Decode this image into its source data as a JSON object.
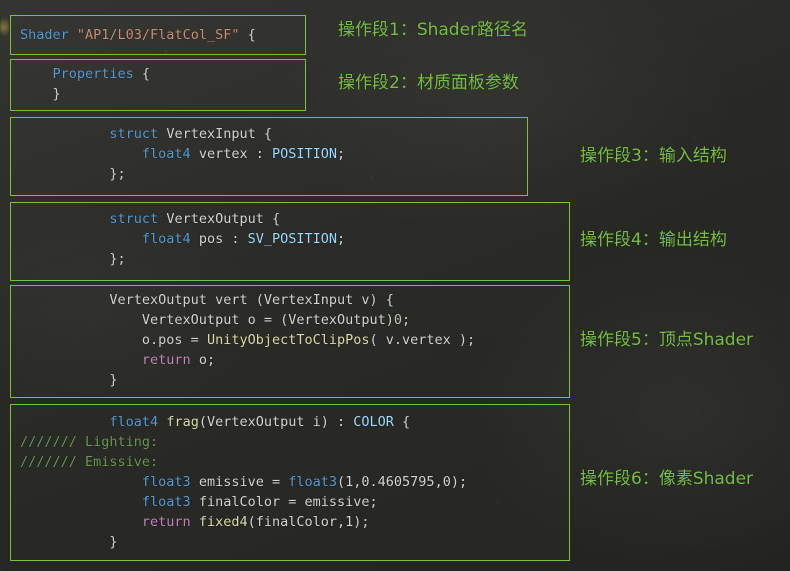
{
  "theme": {
    "background": "#2b2b28",
    "box_border": "#7ac143",
    "annotation_color": "#78c043",
    "code_default": "#d4d4d4",
    "keyword": "#569cd6",
    "string": "#ce9178",
    "semantic": "#9cdcfe",
    "function": "#dcdcaa",
    "return_kw": "#c586c0",
    "comment": "#6a9955"
  },
  "blocks": [
    {
      "id": "shader-path",
      "annotation": "操作段1：Shader路径名",
      "lines": [
        [
          {
            "t": "Shader ",
            "c": "kw"
          },
          {
            "t": "\"AP1/L03/FlatCol_SF\"",
            "c": "str"
          },
          {
            "t": " {",
            "c": "pln"
          }
        ]
      ]
    },
    {
      "id": "properties",
      "annotation": "操作段2：材质面板参数",
      "lines": [
        [
          {
            "t": "    ",
            "c": "pln"
          },
          {
            "t": "Properties",
            "c": "kw"
          },
          {
            "t": " {",
            "c": "pln"
          }
        ],
        [
          {
            "t": "    }",
            "c": "pln"
          }
        ]
      ]
    },
    {
      "id": "vertex-input-struct",
      "annotation": "操作段3：输入结构",
      "lines": [
        [
          {
            "t": "           ",
            "c": "pln"
          },
          {
            "t": "struct",
            "c": "kw"
          },
          {
            "t": " VertexInput {",
            "c": "pln"
          }
        ],
        [
          {
            "t": "               ",
            "c": "pln"
          },
          {
            "t": "float4",
            "c": "kw"
          },
          {
            "t": " vertex : ",
            "c": "pln"
          },
          {
            "t": "POSITION",
            "c": "sem"
          },
          {
            "t": ";",
            "c": "pln"
          }
        ],
        [
          {
            "t": "           };",
            "c": "pln"
          }
        ]
      ]
    },
    {
      "id": "vertex-output-struct",
      "annotation": "操作段4：输出结构",
      "lines": [
        [
          {
            "t": "           ",
            "c": "pln"
          },
          {
            "t": "struct",
            "c": "kw"
          },
          {
            "t": " VertexOutput {",
            "c": "pln"
          }
        ],
        [
          {
            "t": "               ",
            "c": "pln"
          },
          {
            "t": "float4",
            "c": "kw"
          },
          {
            "t": " pos : ",
            "c": "pln"
          },
          {
            "t": "SV_POSITION",
            "c": "sem"
          },
          {
            "t": ";",
            "c": "pln"
          }
        ],
        [
          {
            "t": "           };",
            "c": "pln"
          }
        ]
      ]
    },
    {
      "id": "vertex-shader",
      "annotation": "操作段5：顶点Shader",
      "lines": [
        [
          {
            "t": "           VertexOutput vert (VertexInput v) {",
            "c": "pln"
          }
        ],
        [
          {
            "t": "               VertexOutput o = (VertexOutput)",
            "c": "pln"
          },
          {
            "t": "0",
            "c": "num"
          },
          {
            "t": ";",
            "c": "pln"
          }
        ],
        [
          {
            "t": "               o.pos = ",
            "c": "pln"
          },
          {
            "t": "UnityObjectToClipPos",
            "c": "fn"
          },
          {
            "t": "( v.vertex );",
            "c": "pln"
          }
        ],
        [
          {
            "t": "               ",
            "c": "pln"
          },
          {
            "t": "return",
            "c": "ret"
          },
          {
            "t": " o;",
            "c": "pln"
          }
        ],
        [
          {
            "t": "           }",
            "c": "pln"
          }
        ]
      ]
    },
    {
      "id": "fragment-shader",
      "annotation": "操作段6：像素Shader",
      "lines": [
        [
          {
            "t": "           ",
            "c": "pln"
          },
          {
            "t": "float4",
            "c": "kw"
          },
          {
            "t": " ",
            "c": "pln"
          },
          {
            "t": "frag",
            "c": "fn"
          },
          {
            "t": "(VertexOutput i) : ",
            "c": "pln"
          },
          {
            "t": "COLOR",
            "c": "sem"
          },
          {
            "t": " {",
            "c": "pln"
          }
        ],
        [
          {
            "t": "/////// Lighting:",
            "c": "cmt"
          }
        ],
        [
          {
            "t": "/////// Emissive:",
            "c": "cmt"
          }
        ],
        [
          {
            "t": "               ",
            "c": "pln"
          },
          {
            "t": "float3",
            "c": "kw"
          },
          {
            "t": " emissive = ",
            "c": "pln"
          },
          {
            "t": "float3",
            "c": "kw"
          },
          {
            "t": "(1,0.4605795,0);",
            "c": "pln"
          }
        ],
        [
          {
            "t": "               ",
            "c": "pln"
          },
          {
            "t": "float3",
            "c": "kw"
          },
          {
            "t": " finalColor = emissive;",
            "c": "pln"
          }
        ],
        [
          {
            "t": "               ",
            "c": "pln"
          },
          {
            "t": "return",
            "c": "ret"
          },
          {
            "t": " ",
            "c": "pln"
          },
          {
            "t": "fixed4",
            "c": "fn"
          },
          {
            "t": "(finalColor,1);",
            "c": "pln"
          }
        ],
        [
          {
            "t": "           }",
            "c": "pln"
          }
        ]
      ]
    }
  ]
}
